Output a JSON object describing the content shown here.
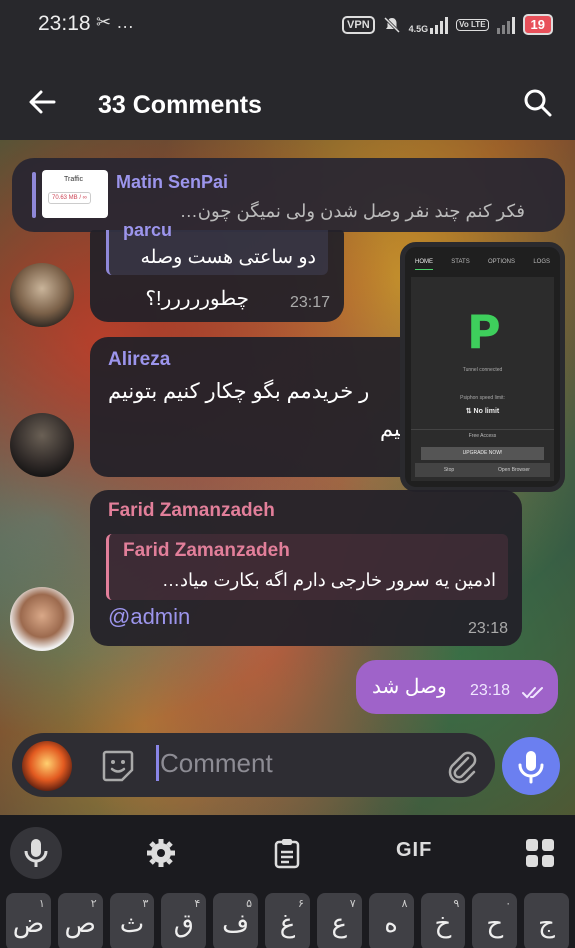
{
  "status_bar": {
    "time": "23:18",
    "left_icons": "✂ …",
    "vpn": "VPN",
    "network": "4.5G",
    "volte": "Vo LTE",
    "battery": "19"
  },
  "header": {
    "title": "33 Comments",
    "back_icon": "arrow-left-icon",
    "search_icon": "search-icon"
  },
  "pinned": {
    "name": "Matin SenPai",
    "text": "فکر کنم چند نفر وصل شدن ولی نمیگن چون…",
    "thumb_title": "Traffic",
    "thumb_value": "70.63 MB / ∞"
  },
  "messages": [
    {
      "partial_name": "parcu",
      "line1": "دو ساعتی هست وصله",
      "line2": "چطوررررر!؟",
      "time": "23:17"
    },
    {
      "name": "Alireza",
      "line1": "ر خریدمم بگو چکار کنیم بتونیم",
      "line2": "نیم"
    },
    {
      "name": "Farid Zamanzadeh",
      "reply_name": "Farid Zamanzadeh",
      "reply_text": "ادمین یه سرور خارجی دارم اگه بکارت میاد…",
      "text": "@admin",
      "time": "23:18"
    }
  ],
  "screenshot": {
    "tabs": [
      "HOME",
      "STATS",
      "OPTIONS",
      "LOGS"
    ],
    "logo": "P",
    "connected": "Tunnel connected",
    "speed_label": "Psiphon speed limit:",
    "speed_value": "⇅ No limit",
    "free": "Free Access",
    "upgrade": "UPGRADE NOW!",
    "stop": "Stop",
    "browser": "Open Browser"
  },
  "outgoing": {
    "text": "وصل شد",
    "time": "23:18"
  },
  "composer": {
    "placeholder": "Comment"
  },
  "keyboard": {
    "gif": "GIF",
    "keys": [
      {
        "char": "ض",
        "hint": "۱"
      },
      {
        "char": "ص",
        "hint": "۲"
      },
      {
        "char": "ث",
        "hint": "۳"
      },
      {
        "char": "ق",
        "hint": "۴"
      },
      {
        "char": "ف",
        "hint": "۵"
      },
      {
        "char": "غ",
        "hint": "۶"
      },
      {
        "char": "ع",
        "hint": "۷"
      },
      {
        "char": "ه",
        "hint": "۸"
      },
      {
        "char": "خ",
        "hint": "۹"
      },
      {
        "char": "ح",
        "hint": "۰"
      },
      {
        "char": "ج",
        "hint": ""
      }
    ]
  },
  "colors": {
    "accent": "#9c95ec",
    "outgoing_bubble": "#9f63c9",
    "farid_name": "#e27f9a",
    "mic_button": "#6b7ff0"
  }
}
